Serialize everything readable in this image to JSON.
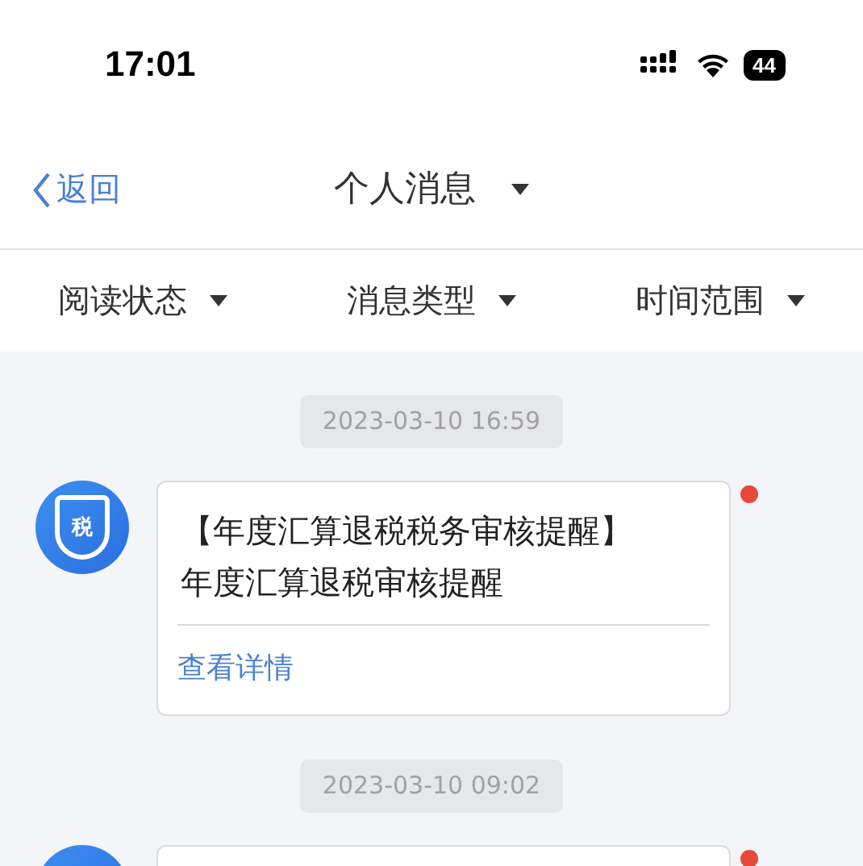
{
  "status_bar": {
    "time": "17:01",
    "battery": "44"
  },
  "nav": {
    "back": "返回",
    "title": "个人消息"
  },
  "filters": [
    {
      "label": "阅读状态"
    },
    {
      "label": "消息类型"
    },
    {
      "label": "时间范围"
    }
  ],
  "messages": [
    {
      "time": "2023-03-10 16:59",
      "unread": true,
      "avatar_label": "税",
      "title": "【年度汇算退税税务审核提醒】",
      "body": "年度汇算退税审核提醒",
      "link": "查看详情"
    },
    {
      "time": "2023-03-10 09:02",
      "unread": true
    }
  ]
}
